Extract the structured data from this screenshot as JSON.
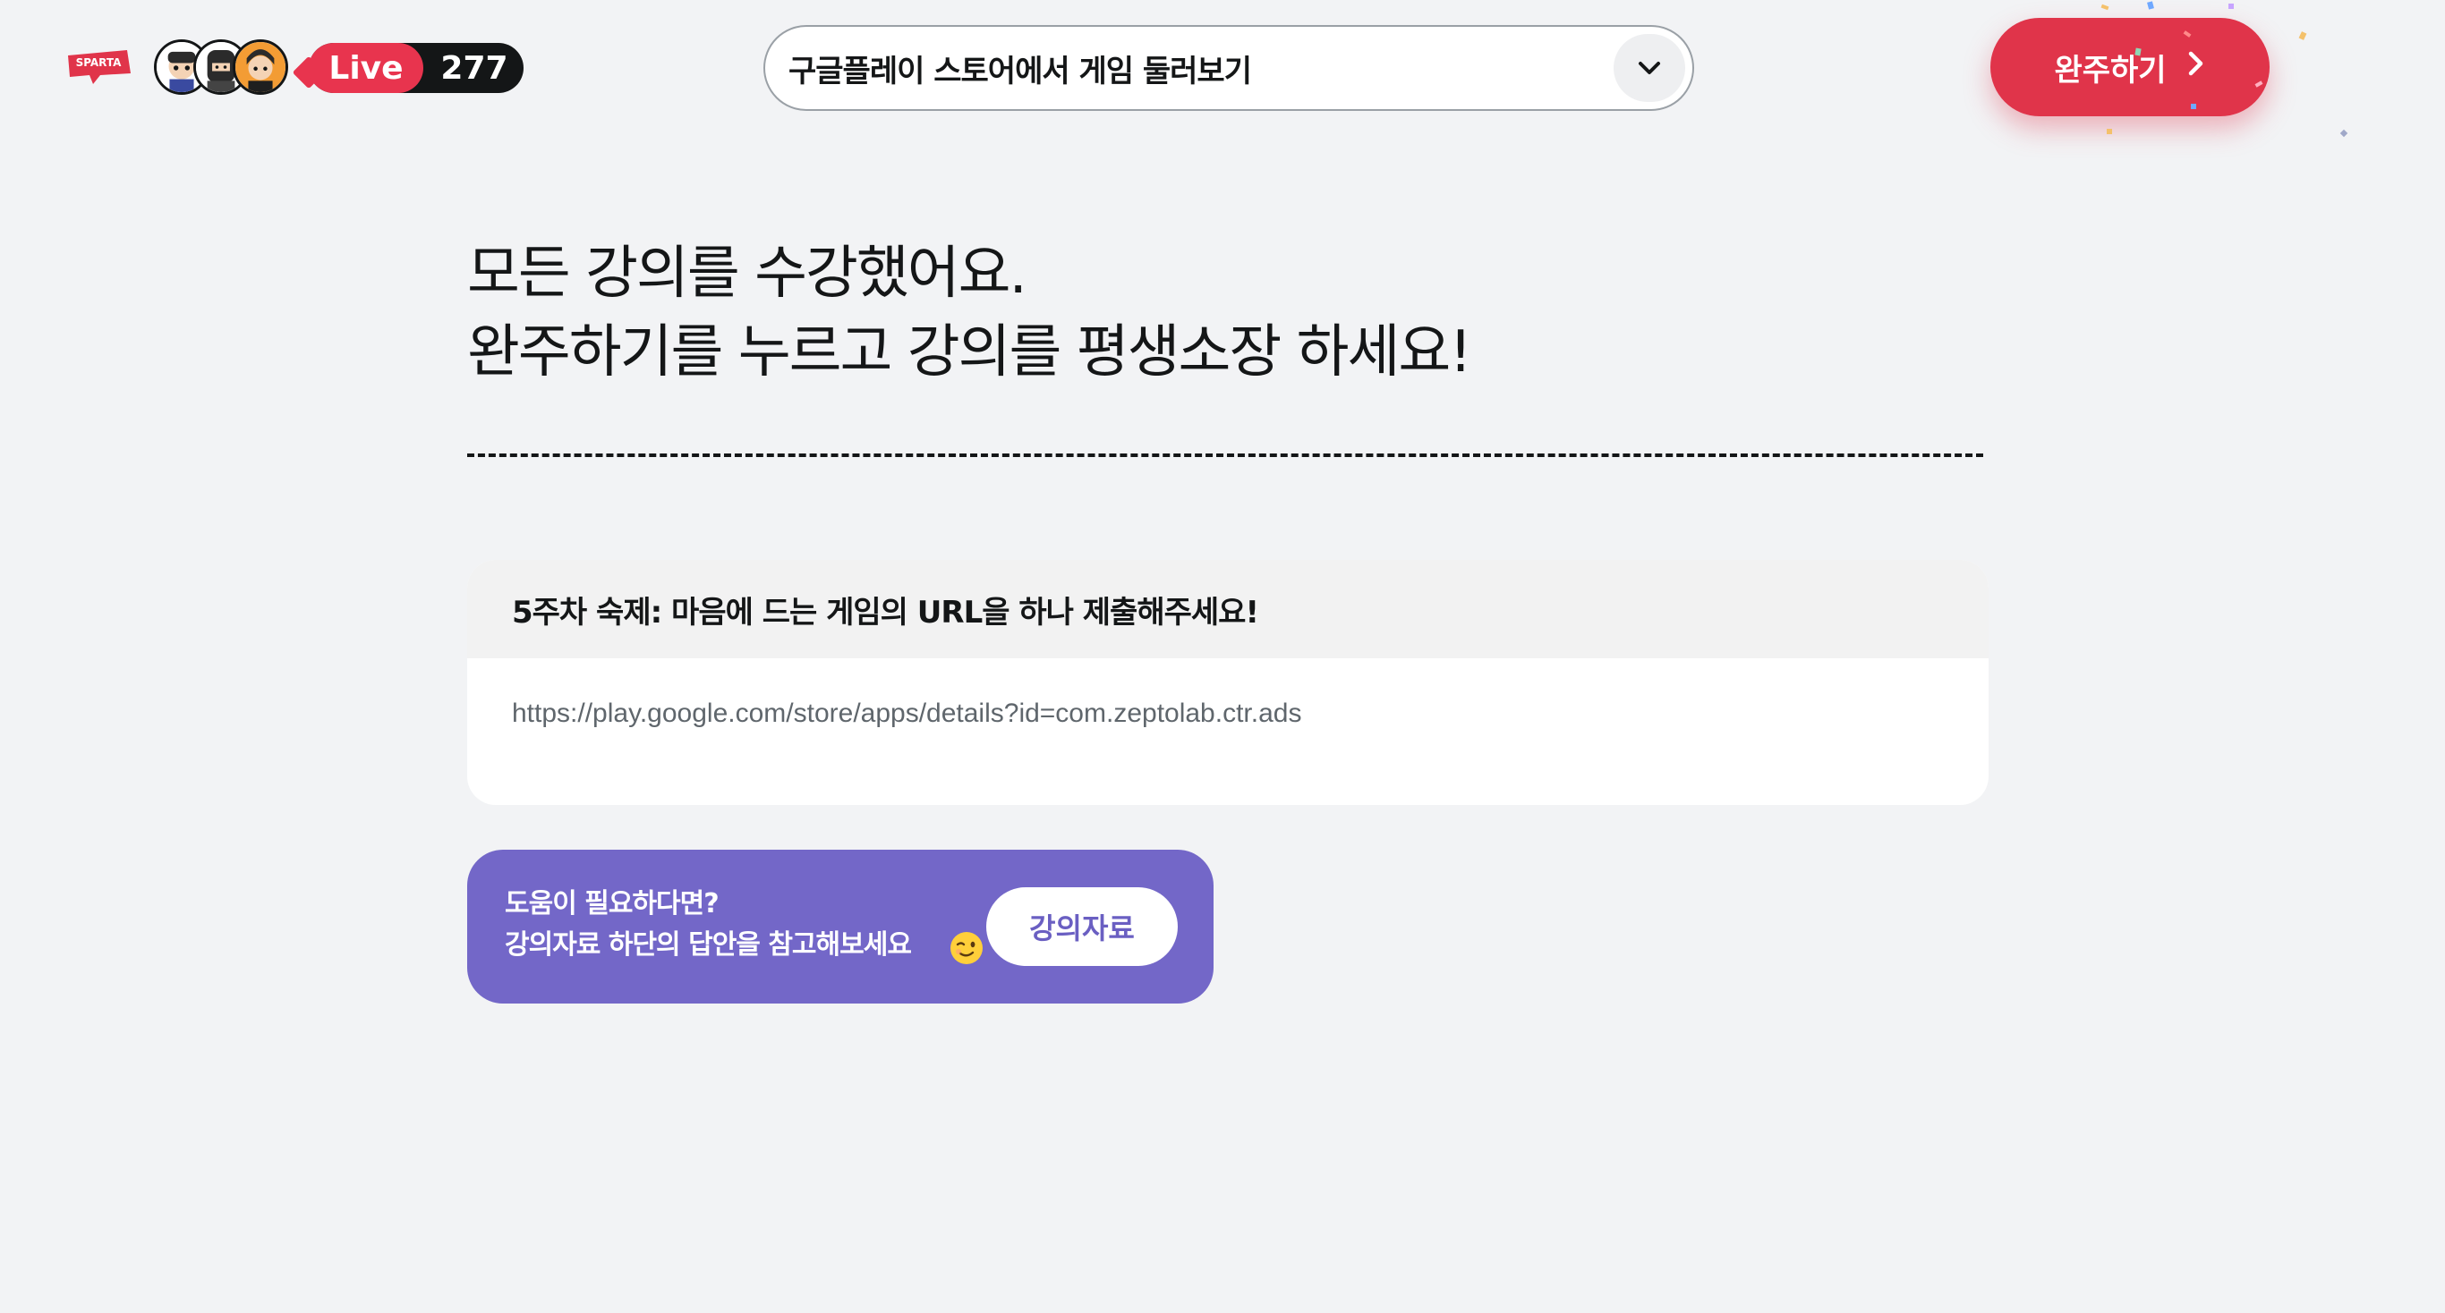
{
  "header": {
    "logo_text": "SPARTA",
    "live_label": "Live",
    "live_count": "277",
    "lecture_select_value": "구글플레이 스토어에서 게임 둘러보기",
    "complete_button_label": "완주하기"
  },
  "main": {
    "headline_line1": "모든 강의를 수강했어요.",
    "headline_line2": "완주하기를 누르고 강의를 평생소장 하세요!",
    "homework": {
      "title": "5주차 숙제: 마음에 드는 게임의 URL을 하나 제출해주세요!",
      "answer": "https://play.google.com/store/apps/details?id=com.zeptolab.ctr.ads"
    },
    "help": {
      "line1": "도움이 필요하다면?",
      "line2": "강의자료 하단의 답안을 참고해보세요",
      "button_label": "강의자료"
    }
  },
  "icons": {
    "logo": "sparta-logo-icon",
    "chevron": "chevron-down-icon",
    "arrow": "chevron-right-icon",
    "wink": "wink-emoji-icon"
  },
  "colors": {
    "background": "#f2f3f5",
    "accent_red": "#e0344a",
    "live_red": "#e8344e",
    "help_purple": "#7367c8",
    "text_dark": "#141617"
  }
}
